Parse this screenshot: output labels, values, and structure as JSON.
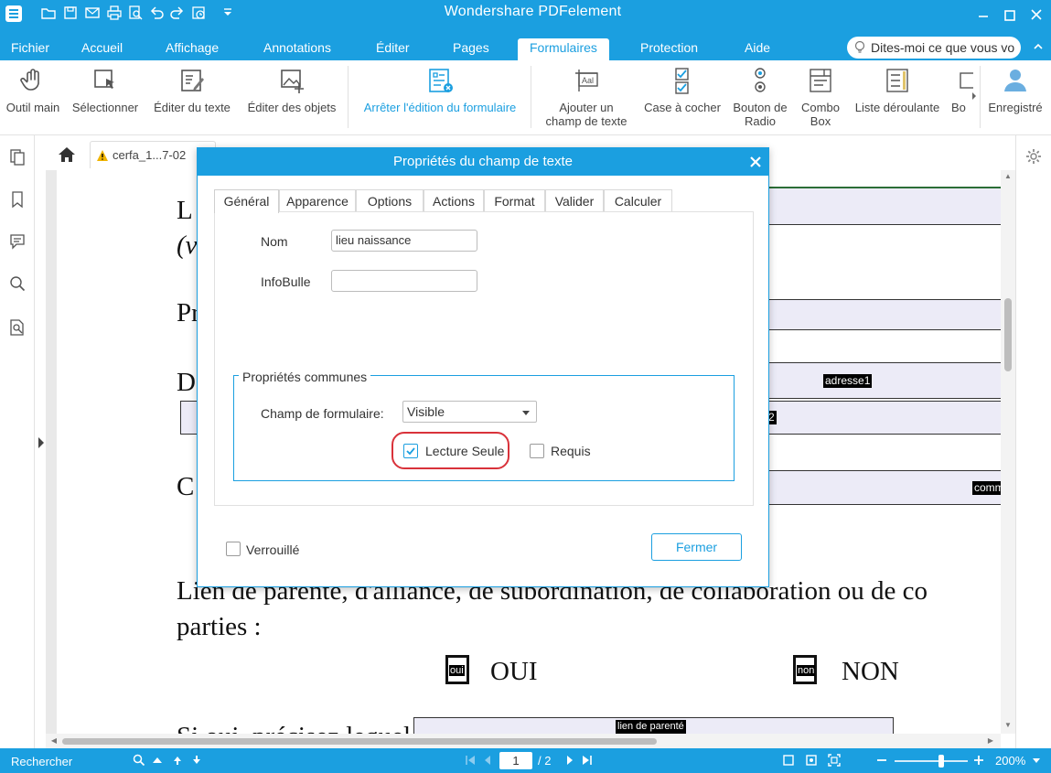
{
  "app": {
    "title": "Wondershare PDFelement"
  },
  "menu": {
    "items": [
      "Fichier",
      "Accueil",
      "Affichage",
      "Annotations",
      "Éditer",
      "Pages",
      "Formulaires",
      "Protection",
      "Aide"
    ],
    "active": "Formulaires",
    "tell_me": "Dites-moi ce que vous vo"
  },
  "ribbon": {
    "outil_main": "Outil main",
    "selectionner": "Sélectionner",
    "editer_texte": "Éditer du texte",
    "editer_objets": "Éditer des objets",
    "arreter_edition": "Arrêter l'édition du formulaire",
    "ajouter_champ_1": "Ajouter un",
    "ajouter_champ_2": "champ de texte",
    "case_cocher": "Case à cocher",
    "bouton_radio_1": "Bouton de",
    "bouton_radio_2": "Radio",
    "combo_box_1": "Combo",
    "combo_box_2": "Box",
    "liste_deroulante": "Liste déroulante",
    "bouton_partial": "Bo",
    "enregistre": "Enregistré"
  },
  "tabs": {
    "document": "cerfa_1...7-02"
  },
  "document": {
    "lines": [
      "L",
      "(v",
      "Pr",
      "D",
      "C"
    ],
    "lien_1": "Lien de parenté, d'alliance, de subordination, de collaboration ou de co",
    "lien_2": "parties :",
    "oui": "OUI",
    "non": "NON",
    "oui_tag": "oui",
    "non_tag": "non",
    "field_adresse1": "adresse1",
    "field_2": "2",
    "field_comm": "comm",
    "field_lien": "lien de parenté",
    "bottom_text": "Si oui, précisez lequel :"
  },
  "dialog": {
    "title": "Propriétés du champ de texte",
    "tabs": [
      "Général",
      "Apparence",
      "Options",
      "Actions",
      "Format",
      "Valider",
      "Calculer"
    ],
    "active_tab": "Général",
    "nom_label": "Nom",
    "nom_value": "lieu naissance",
    "infobulle_label": "InfoBulle",
    "infobulle_value": "",
    "group_title": "Propriétés communes",
    "champ_label": "Champ de formulaire:",
    "champ_value": "Visible",
    "lecture_seule": "Lecture Seule",
    "lecture_seule_checked": true,
    "requis": "Requis",
    "requis_checked": false,
    "verrouille": "Verrouillé",
    "verrouille_checked": false,
    "fermer": "Fermer"
  },
  "statusbar": {
    "search": "Rechercher",
    "page_current": "1",
    "page_total": "/ 2",
    "zoom": "200%"
  },
  "colors": {
    "accent": "#1b9fe0",
    "highlight_ring": "#d9323a"
  }
}
